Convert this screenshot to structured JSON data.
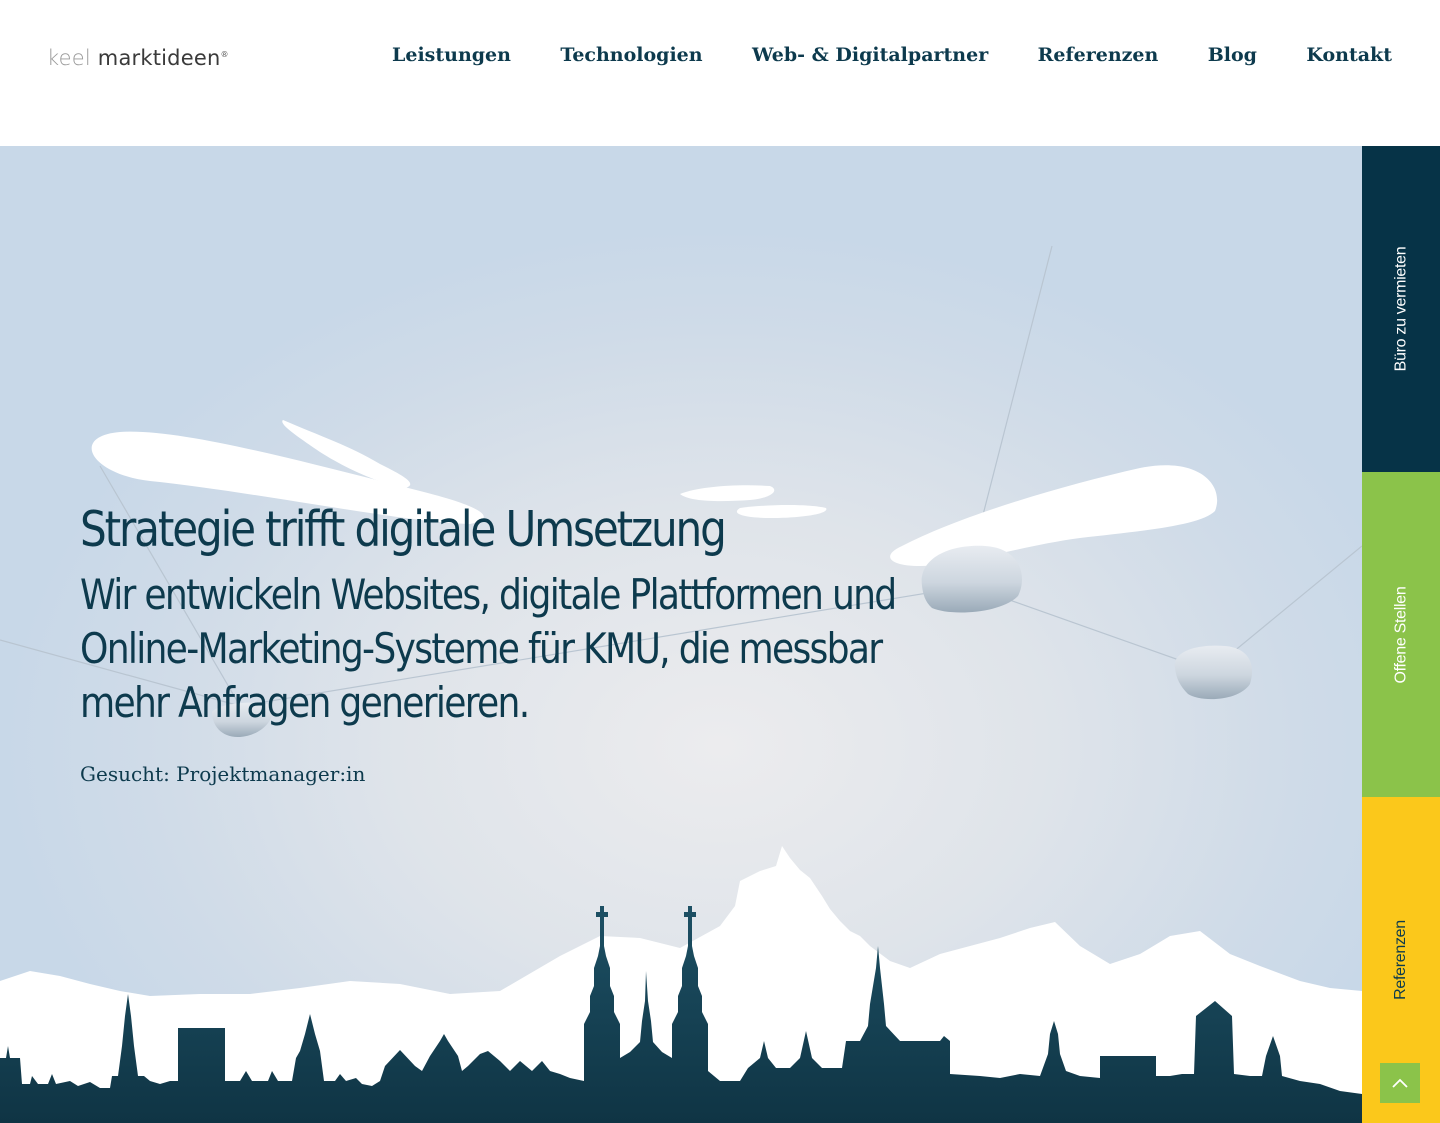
{
  "logo": {
    "part1": "keel",
    "part2": "marktideen",
    "mark": "®"
  },
  "nav": [
    {
      "label": "Leistungen"
    },
    {
      "label": "Technologien"
    },
    {
      "label": "Web- & Digitalpartner"
    },
    {
      "label": "Referenzen"
    },
    {
      "label": "Blog"
    },
    {
      "label": "Kontakt"
    }
  ],
  "hero": {
    "title": "Strategie trifft digitale Umsetzung",
    "subtitle": "Wir entwickeln Websites, digitale Plattformen und Online-Marketing-Systeme für KMU, die messbar mehr Anfragen generieren.",
    "link": "Gesucht: Projektmanager:in"
  },
  "side_tabs": [
    {
      "label": "Büro zu vermieten",
      "color": "#063347"
    },
    {
      "label": "Offene Stellen",
      "color": "#8bc34a"
    },
    {
      "label": "Referenzen",
      "color": "#fbc81b"
    }
  ],
  "scroll_top": {
    "icon": "chevron-up-icon"
  },
  "colors": {
    "brand_dark": "#0d3a4d",
    "accent_green": "#8bc34a",
    "accent_yellow": "#fbc81b",
    "skyline": "#1c4b5f"
  }
}
